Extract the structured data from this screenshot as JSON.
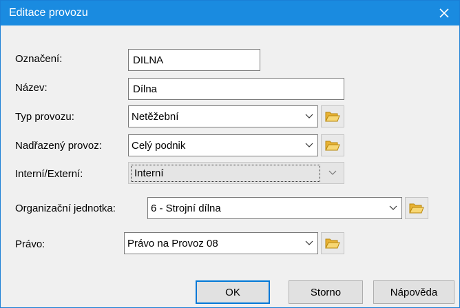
{
  "window": {
    "title": "Editace provozu"
  },
  "fields": {
    "oznaceni": {
      "label": "Označení:",
      "value": "DILNA"
    },
    "nazev": {
      "label": "Název:",
      "value": "Dílna"
    },
    "typ_provozu": {
      "label": "Typ provozu:",
      "value": "Netěžební"
    },
    "nadrazeny_provoz": {
      "label": "Nadřazený provoz:",
      "value": "Celý podnik"
    },
    "interni_externi": {
      "label": "Interní/Externí:",
      "value": "Interní",
      "disabled": true
    },
    "organizacni_jednotka": {
      "label": "Organizační jednotka:",
      "value": "6 - Strojní dílna"
    },
    "pravo": {
      "label": "Právo:",
      "value": "Právo na Provoz 08"
    }
  },
  "buttons": {
    "ok": "OK",
    "storno": "Storno",
    "napoveda": "Nápověda"
  },
  "icons": {
    "folder": "folder-open-icon",
    "dropdown": "chevron-down-icon",
    "close": "close-icon"
  },
  "colors": {
    "titlebar": "#1a8be0",
    "dialog_bg": "#f0f0f0",
    "default_button_border": "#0078d7",
    "folder_yellow": "#f3c84f"
  }
}
